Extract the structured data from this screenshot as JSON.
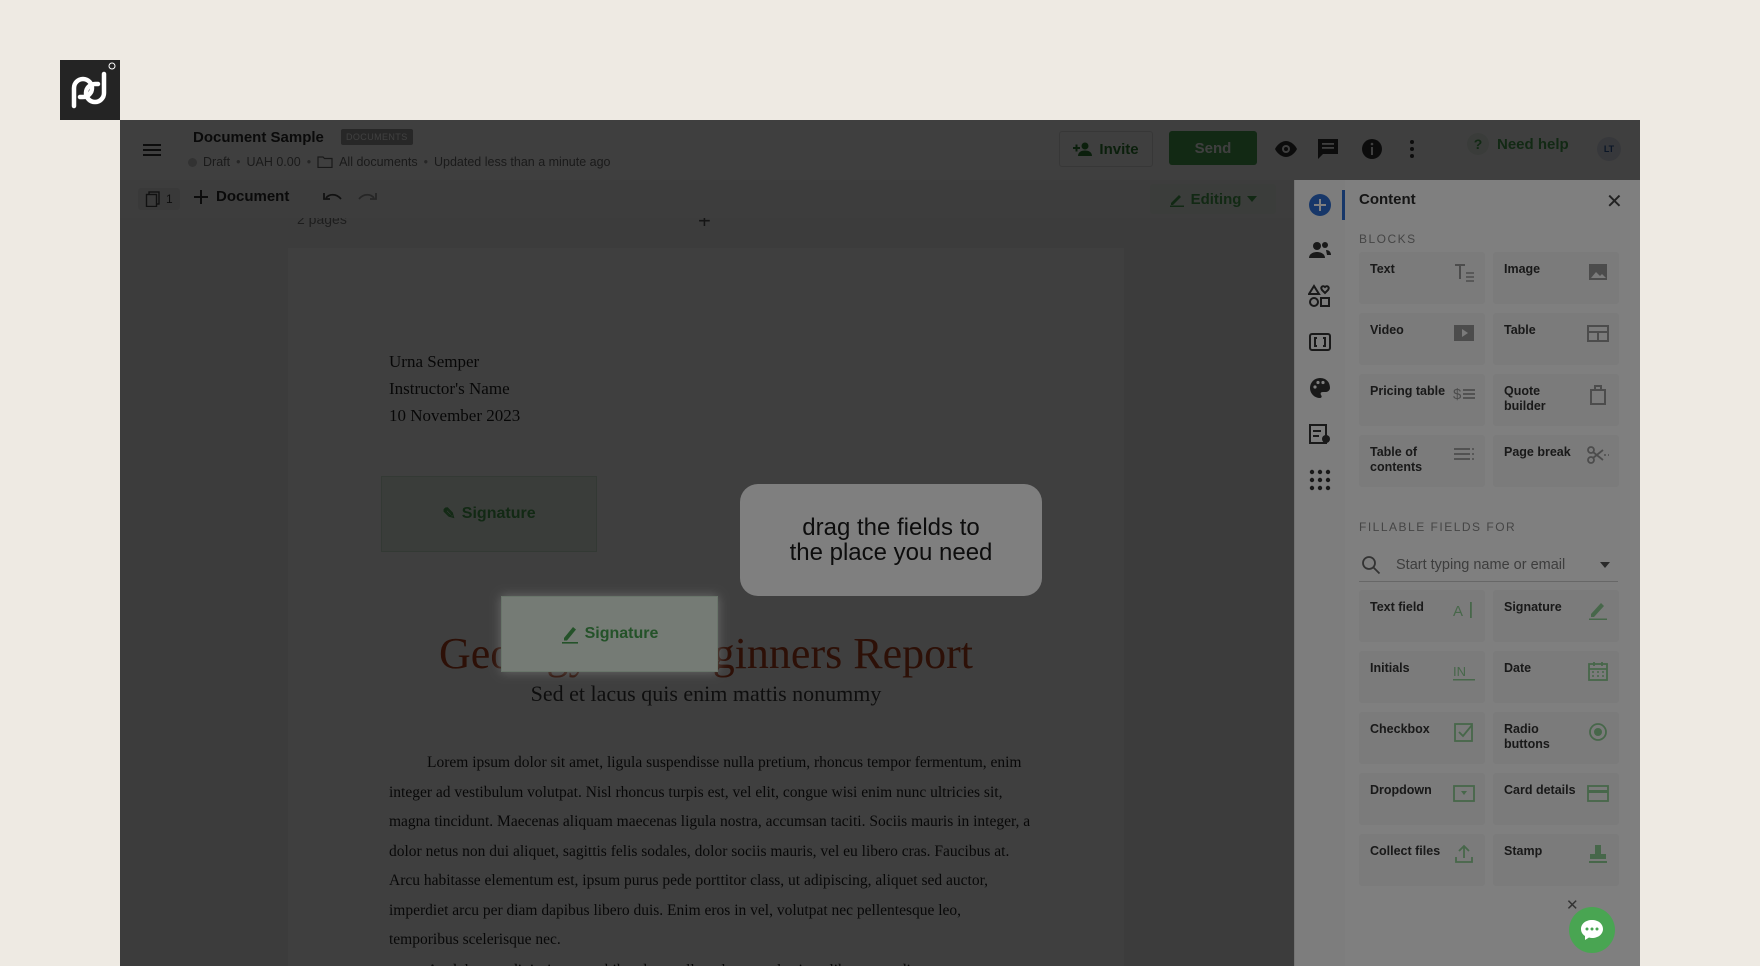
{
  "header": {
    "doc_title": "Document Sample",
    "doc_badge": "DOCUMENTS",
    "status": "Draft",
    "amount": "UAH 0.00",
    "folder": "All documents",
    "updated": "Updated less than a minute ago",
    "invite_label": "Invite",
    "send_label": "Send",
    "help_label": "Need help",
    "avatar_initials": "LT"
  },
  "toolbar": {
    "pages_count": "1",
    "add_document_label": "Document",
    "mode_label": "Editing"
  },
  "document": {
    "pages_label": "2 pages",
    "address_lines": [
      "Urna Semper",
      "Instructor's Name",
      "10 November 2023"
    ],
    "signature_label": "Signature",
    "title": "Geology for Beginners Report",
    "subtitle": "Sed et lacus quis enim mattis nonummy",
    "paragraph": "Lorem ipsum dolor sit amet, ligula suspendisse nulla pretium, rhoncus tempor fermentum, enim integer ad vestibulum volutpat. Nisl rhoncus turpis est, vel elit, congue wisi enim nunc ultricies sit, magna tincidunt. Maecenas aliquam maecenas ligula nostra, accumsan taciti. Sociis mauris in integer, a dolor netus non dui aliquet, sagittis felis sodales, dolor sociis mauris, vel eu libero cras. Faucibus at. Arcu habitasse elementum est, ipsum purus pede porttitor class, ut adipiscing, aliquet sed auctor, imperdiet arcu per diam dapibus libero duis. Enim eros in vel, volutpat nec pellentesque leo, temporibus scelerisque nec.",
    "paragraph2_fragment": "Ac dolor ac adipiscing amet bibendum nullam, lacus molestie ut libero nec, diam et"
  },
  "tooltip": {
    "line1": "drag the fields to",
    "line2": "the place you need"
  },
  "panel": {
    "title": "Content",
    "blocks_header": "BLOCKS",
    "blocks": [
      {
        "label": "Text",
        "icon": "text-format-icon"
      },
      {
        "label": "Image",
        "icon": "image-icon"
      },
      {
        "label": "Video",
        "icon": "video-icon"
      },
      {
        "label": "Table",
        "icon": "table-icon"
      },
      {
        "label": "Pricing table",
        "icon": "pricing-table-icon"
      },
      {
        "label": "Quote builder",
        "icon": "quote-builder-icon"
      },
      {
        "label": "Table of contents",
        "icon": "toc-icon"
      },
      {
        "label": "Page break",
        "icon": "scissors-icon"
      }
    ],
    "fields_header": "FILLABLE FIELDS FOR",
    "search_placeholder": "Start typing name or email",
    "fields": [
      {
        "label": "Text field",
        "icon": "text-field-icon"
      },
      {
        "label": "Signature",
        "icon": "pen-icon"
      },
      {
        "label": "Initials",
        "icon": "initials-icon"
      },
      {
        "label": "Date",
        "icon": "calendar-icon"
      },
      {
        "label": "Checkbox",
        "icon": "checkbox-icon"
      },
      {
        "label": "Radio buttons",
        "icon": "radio-icon"
      },
      {
        "label": "Dropdown",
        "icon": "dropdown-icon"
      },
      {
        "label": "Card details",
        "icon": "card-icon"
      },
      {
        "label": "Collect files",
        "icon": "upload-icon"
      },
      {
        "label": "Stamp",
        "icon": "stamp-icon"
      }
    ]
  },
  "colors": {
    "accent_green": "#49a552",
    "rail_active_blue": "#2f6fd3",
    "title_red": "#b7431f"
  }
}
